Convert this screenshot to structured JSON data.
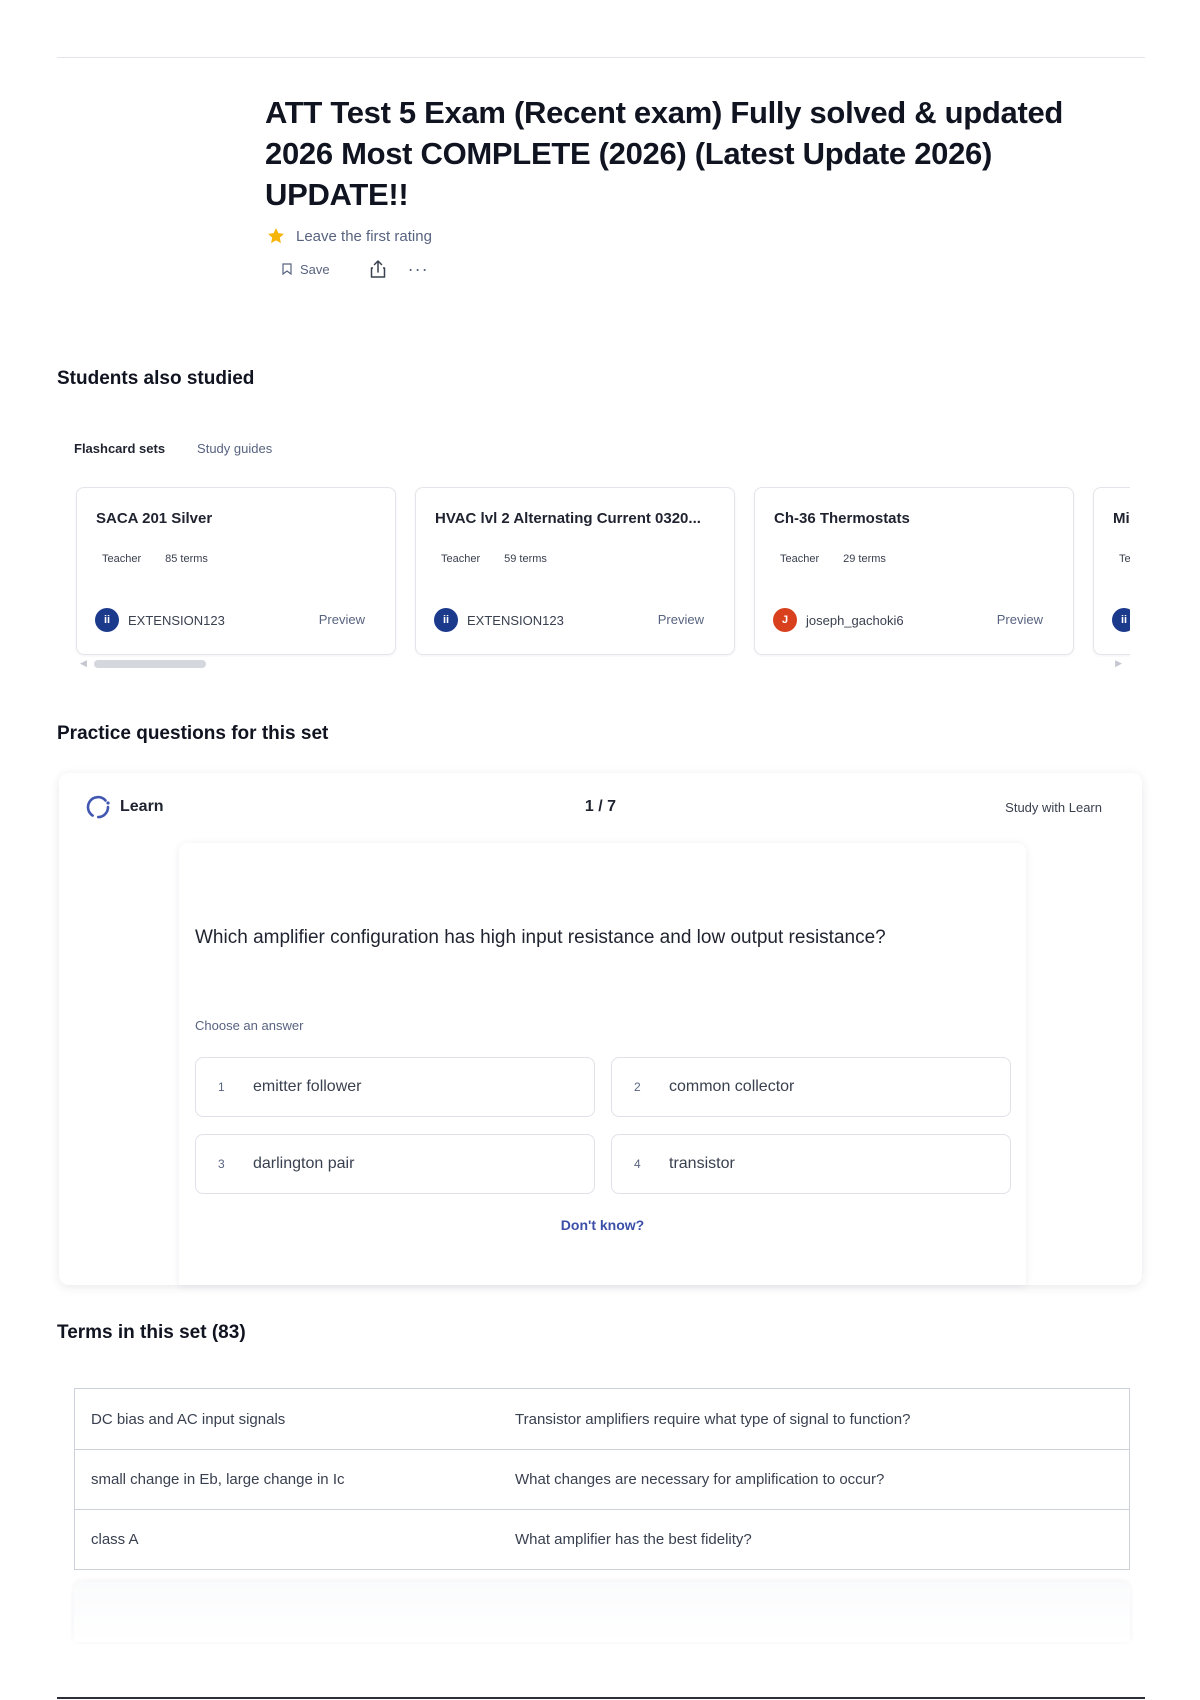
{
  "set": {
    "title": "ATT Test 5 Exam (Recent exam) Fully solved & updated 2026 Most COMPLETE (2026) (Latest Update 2026) UPDATE!!",
    "rating_text": "Leave the first rating",
    "save_label": "Save",
    "more_label": "···"
  },
  "students_also_studied": {
    "heading": "Students also studied",
    "tabs": [
      "Flashcard sets",
      "Study guides"
    ],
    "cards": [
      {
        "title": "SACA 201 Silver",
        "role": "Teacher",
        "terms": "85 terms",
        "author": "EXTENSION123",
        "avatar_color": "#1b3a8c",
        "avatar_text": "ii",
        "preview": "Preview"
      },
      {
        "title": "HVAC lvl 2 Alternating Current 0320...",
        "role": "Teacher",
        "terms": "59 terms",
        "author": "EXTENSION123",
        "avatar_color": "#1b3a8c",
        "avatar_text": "ii",
        "preview": "Preview"
      },
      {
        "title": "Ch-36 Thermostats",
        "role": "Teacher",
        "terms": "29 terms",
        "author": "joseph_gachoki6",
        "avatar_color": "#d9411e",
        "avatar_text": "J",
        "preview": "Preview"
      },
      {
        "title": "Mi",
        "role": "Te",
        "terms": "",
        "author": "",
        "avatar_color": "#1b3a8c",
        "avatar_text": "ii",
        "preview": ""
      }
    ]
  },
  "practice": {
    "heading": "Practice questions for this set",
    "mode": "Learn",
    "progress": "1 / 7",
    "study_button": "Study with Learn",
    "question": "Which amplifier configuration has high input resistance and low output resistance?",
    "prompt": "Choose an answer",
    "answers": [
      {
        "num": "1",
        "text": "emitter follower"
      },
      {
        "num": "2",
        "text": "common collector"
      },
      {
        "num": "3",
        "text": "darlington pair"
      },
      {
        "num": "4",
        "text": "transistor"
      }
    ],
    "dont_know": "Don't know?"
  },
  "terms": {
    "heading": "Terms in this set (83)",
    "rows": [
      {
        "term": "DC bias and AC input signals",
        "definition": "Transistor amplifiers require what type of signal to function?"
      },
      {
        "term": "small change in Eb, large change in Ic",
        "definition": "What changes are necessary for amplification to occur?"
      },
      {
        "term": "class A",
        "definition": "What amplifier has the best fidelity?"
      }
    ]
  },
  "colors": {
    "accent_blue": "#3c4fa8",
    "star": "#f5b50a",
    "learn_icon": "#4257b2"
  }
}
